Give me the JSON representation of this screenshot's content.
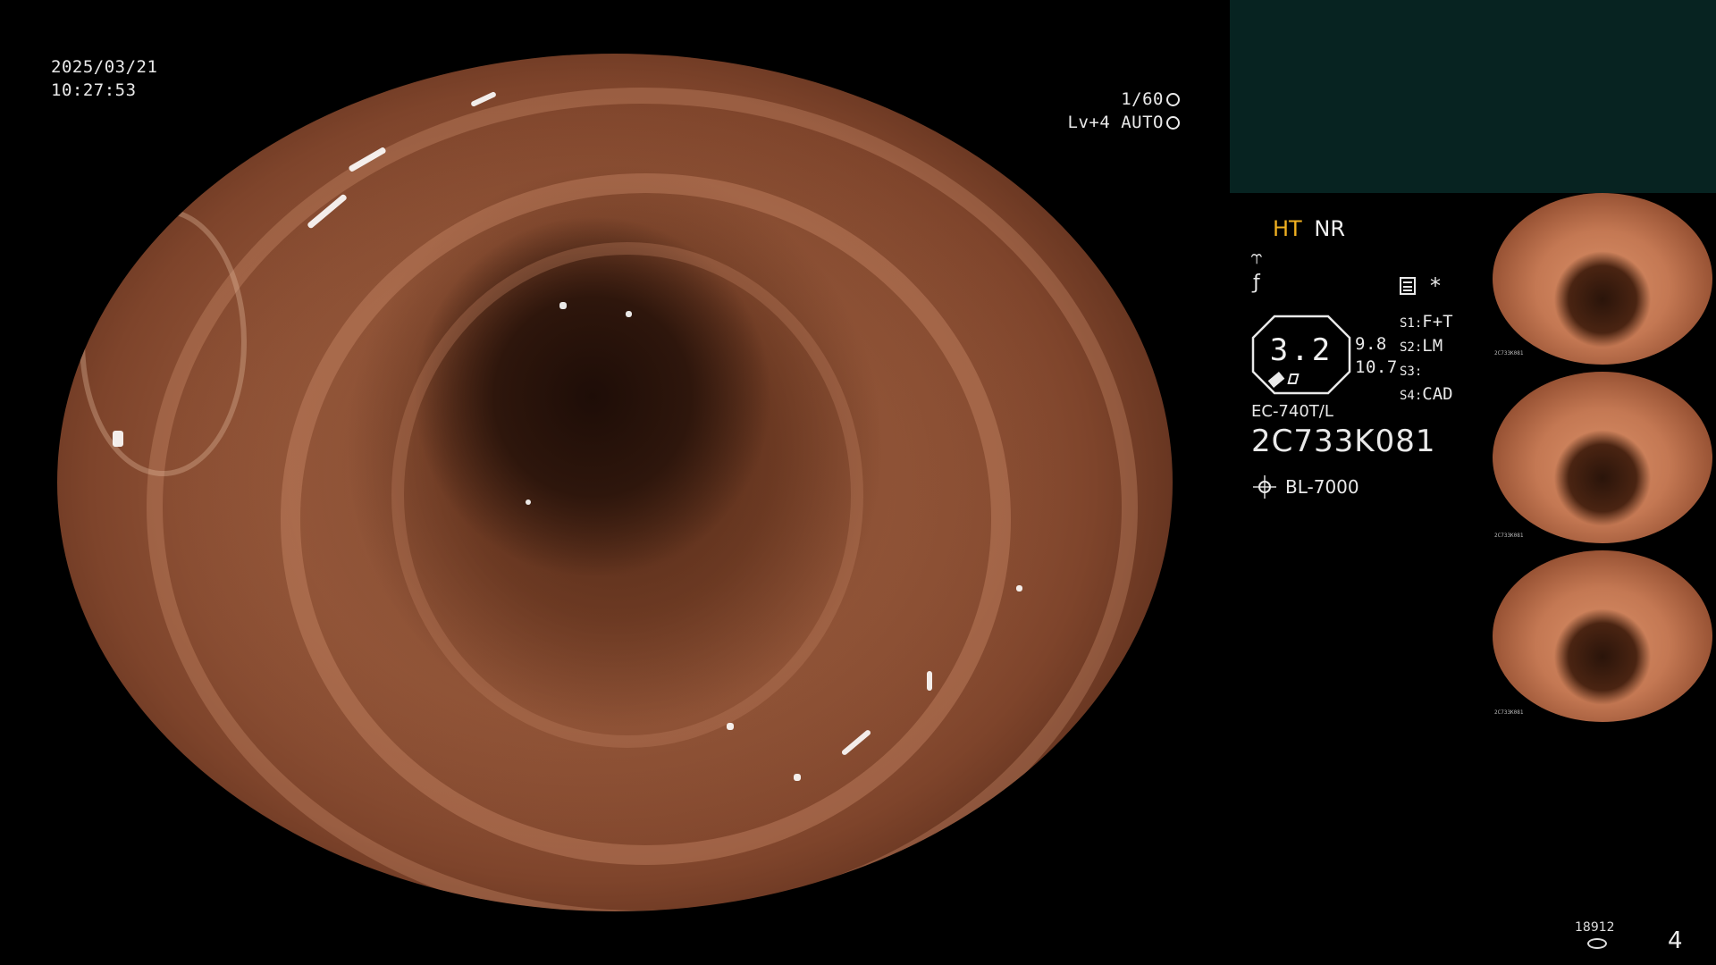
{
  "datetime": {
    "date": "2025/03/21",
    "time": "10:27:53"
  },
  "exposure": {
    "shutter": "1/60",
    "level": "Lv+4",
    "mode": "AUTO"
  },
  "settings": {
    "ht_label": "HT",
    "nr_label": "NR",
    "zoom_value": "3.2",
    "dist_1": "9.8",
    "dist_2": "10.7",
    "s1": {
      "key": "S1:",
      "value": "F+T"
    },
    "s2": {
      "key": "S2:",
      "value": "LM"
    },
    "s3": {
      "key": "S3:",
      "value": ""
    },
    "s4": {
      "key": "S4:",
      "value": "CAD"
    },
    "star": "*"
  },
  "scope": {
    "model": "EC-740T/L",
    "serial": "2C733K081"
  },
  "light_source": {
    "model": "BL-7000"
  },
  "footer": {
    "storage_count": "18912",
    "page_number": "4"
  },
  "thumbnails": [
    {
      "serial": "2C733K081"
    },
    {
      "serial": "2C733K081"
    },
    {
      "serial": "2C733K081"
    }
  ],
  "colors": {
    "ht_label": "#f0b020",
    "panel_bar": "#072321",
    "background": "#000000"
  },
  "icons": [
    "shutter-icon",
    "auto-mode-icon",
    "structure-enhance-icon",
    "color-enhance-icon",
    "memo-icon",
    "camera-tip-icon",
    "light-source-icon",
    "storage-icon"
  ]
}
